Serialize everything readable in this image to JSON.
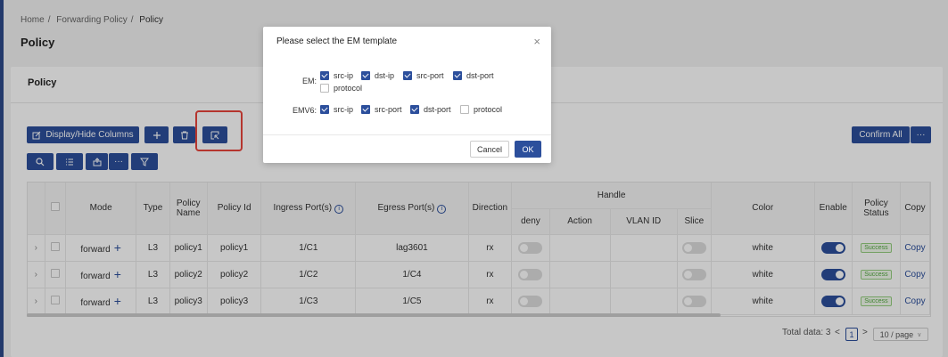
{
  "breadcrumb": [
    "Home",
    "Forwarding Policy",
    "Policy"
  ],
  "page_title": "Policy",
  "card_title": "Policy",
  "toolbar": {
    "display_hide_label": "Display/Hide Columns",
    "confirm_all_label": "Confirm All",
    "more_label": "···",
    "icon_more_label": "···"
  },
  "table": {
    "headers": {
      "mode": "Mode",
      "type": "Type",
      "policy_name": "Policy Name",
      "policy_id": "Policy Id",
      "ingress": "Ingress Port(s)",
      "egress": "Egress Port(s)",
      "direction": "Direction",
      "handle": "Handle",
      "deny": "deny",
      "action": "Action",
      "vlan_id": "VLAN ID",
      "slice": "Slice",
      "color": "Color",
      "enable": "Enable",
      "policy_status": "Policy Status",
      "copy": "Copy"
    },
    "rows": [
      {
        "mode": "forward",
        "type": "L3",
        "name": "policy1",
        "id": "policy1",
        "ingress": "1/C1",
        "egress": "lag3601",
        "direction": "rx",
        "color": "white",
        "status": "Success",
        "copy": "Copy"
      },
      {
        "mode": "forward",
        "type": "L3",
        "name": "policy2",
        "id": "policy2",
        "ingress": "1/C2",
        "egress": "1/C4",
        "direction": "rx",
        "color": "white",
        "status": "Success",
        "copy": "Copy"
      },
      {
        "mode": "forward",
        "type": "L3",
        "name": "policy3",
        "id": "policy3",
        "ingress": "1/C3",
        "egress": "1/C5",
        "direction": "rx",
        "color": "white",
        "status": "Success",
        "copy": "Copy"
      }
    ]
  },
  "pagination": {
    "total_label": "Total data: 3",
    "prev": "<",
    "current_page": "1",
    "next": ">",
    "page_size": "10 / page"
  },
  "modal": {
    "title": "Please select the EM template",
    "close": "×",
    "em_label": "EM:",
    "em_options": [
      {
        "label": "src-ip",
        "checked": true
      },
      {
        "label": "dst-ip",
        "checked": true
      },
      {
        "label": "src-port",
        "checked": true
      },
      {
        "label": "dst-port",
        "checked": true
      },
      {
        "label": "protocol",
        "checked": false
      }
    ],
    "emv6_label": "EMV6:",
    "emv6_options": [
      {
        "label": "src-ip",
        "checked": true
      },
      {
        "label": "src-port",
        "checked": true
      },
      {
        "label": "dst-port",
        "checked": true
      },
      {
        "label": "protocol",
        "checked": false
      }
    ],
    "cancel_label": "Cancel",
    "ok_label": "OK"
  },
  "colors": {
    "primary": "#2c4f9c",
    "highlight": "#e8453c",
    "success": "#52a83f"
  }
}
